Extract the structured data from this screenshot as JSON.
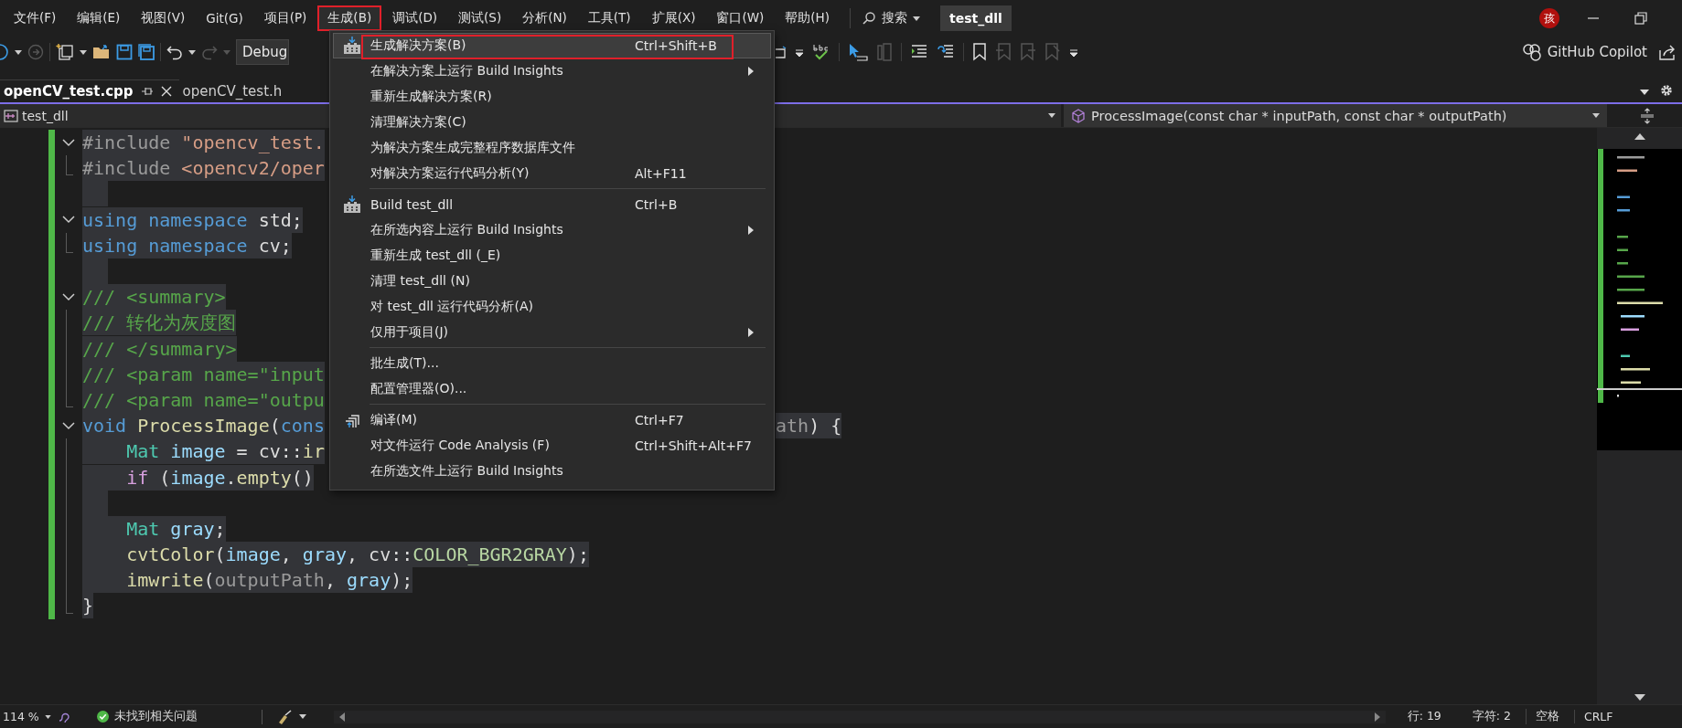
{
  "menubar": {
    "items": [
      {
        "label": "文件(F)",
        "selected": false,
        "outlined": false
      },
      {
        "label": "编辑(E)",
        "selected": false,
        "outlined": false
      },
      {
        "label": "视图(V)",
        "selected": false,
        "outlined": false
      },
      {
        "label": "Git(G)",
        "selected": false,
        "outlined": false
      },
      {
        "label": "项目(P)",
        "selected": false,
        "outlined": false
      },
      {
        "label": "生成(B)",
        "selected": true,
        "outlined": true
      },
      {
        "label": "调试(D)",
        "selected": false,
        "outlined": false
      },
      {
        "label": "测试(S)",
        "selected": false,
        "outlined": false
      },
      {
        "label": "分析(N)",
        "selected": false,
        "outlined": false
      },
      {
        "label": "工具(T)",
        "selected": false,
        "outlined": false
      },
      {
        "label": "扩展(X)",
        "selected": false,
        "outlined": false
      },
      {
        "label": "窗口(W)",
        "selected": false,
        "outlined": false
      },
      {
        "label": "帮助(H)",
        "selected": false,
        "outlined": false
      }
    ],
    "search": "搜索",
    "solution": "test_dll",
    "avatar": "孩"
  },
  "toolbar": {
    "configuration": "Debug",
    "copilot": "GitHub Copilot"
  },
  "tabs": [
    {
      "label": "openCV_test.cpp",
      "selected": true
    },
    {
      "label": "openCV_test.h",
      "selected": false
    }
  ],
  "navbar": {
    "project": "test_dll",
    "member": "ProcessImage(const char * inputPath, const char * outputPath)"
  },
  "editor": {
    "lines": [
      {
        "kind": "opening",
        "selected": true,
        "tokens": [
          {
            "text": "#include",
            "kind": "directive"
          },
          {
            "text": " \"opencv_test.",
            "kind": "string"
          }
        ]
      },
      {
        "kind": "closing",
        "selected": true,
        "tokens": [
          {
            "text": "#include",
            "kind": "directive"
          },
          {
            "text": " <opencv2/oper",
            "kind": "string"
          }
        ]
      },
      {
        "kind": "plain",
        "selected": true
      },
      {
        "kind": "opening",
        "selected": true,
        "tokens": [
          {
            "text": "using",
            "kind": "keyword"
          },
          {
            "text": " namespace",
            "kind": "keyword"
          },
          {
            "text": " std;",
            "kind": "plain"
          }
        ]
      },
      {
        "kind": "closing",
        "selected": true,
        "tokens": [
          {
            "text": "using",
            "kind": "keyword"
          },
          {
            "text": " namespace",
            "kind": "keyword"
          },
          {
            "text": " cv;",
            "kind": "plain"
          }
        ]
      },
      {
        "kind": "plain",
        "selected": true
      },
      {
        "kind": "opening",
        "selected": true,
        "tokens": [
          {
            "text": "/// <summary>",
            "kind": "comment"
          }
        ]
      },
      {
        "kind": "inner",
        "selected": true,
        "tokens": [
          {
            "text": "/// 转化为灰度图",
            "kind": "comment"
          }
        ]
      },
      {
        "kind": "inner",
        "selected": true,
        "tokens": [
          {
            "text": "/// </summary>",
            "kind": "comment"
          }
        ]
      },
      {
        "kind": "inner",
        "selected": true,
        "tokens": [
          {
            "text": "/// <param name=\"input",
            "kind": "comment"
          }
        ]
      },
      {
        "kind": "closing",
        "selected": true,
        "tokens": [
          {
            "text": "/// <param name=\"outpu",
            "kind": "comment"
          }
        ]
      },
      {
        "kind": "opening",
        "selected": true,
        "tokens": [
          {
            "text": "void",
            "kind": "keyword"
          },
          {
            "text": " ProcessImage",
            "kind": "function"
          },
          {
            "text": "(",
            "kind": "plain"
          },
          {
            "text": "cons",
            "kind": "keyword"
          }
        ],
        "tail": [
          {
            "text": "ath",
            "kind": "parameter"
          },
          {
            "text": ") {",
            "kind": "plain"
          }
        ]
      },
      {
        "kind": "inner",
        "selected": true,
        "tokens": [
          {
            "text": "    Mat",
            "kind": "type"
          },
          {
            "text": " image",
            "kind": "variable"
          },
          {
            "text": " = cv::",
            "kind": "plain"
          },
          {
            "text": "ir",
            "kind": "function"
          }
        ]
      },
      {
        "kind": "inner",
        "selected": true,
        "tokens": [
          {
            "text": "    if",
            "kind": "control"
          },
          {
            "text": " (",
            "kind": "plain"
          },
          {
            "text": "image",
            "kind": "variable"
          },
          {
            "text": ".",
            "kind": "plain"
          },
          {
            "text": "empty",
            "kind": "function"
          },
          {
            "text": "()",
            "kind": "plain"
          }
        ]
      },
      {
        "kind": "inner",
        "selected": true
      },
      {
        "kind": "inner",
        "selected": true,
        "tokens": [
          {
            "text": "    Mat",
            "kind": "type"
          },
          {
            "text": " gray",
            "kind": "variable"
          },
          {
            "text": ";",
            "kind": "plain"
          }
        ]
      },
      {
        "kind": "inner",
        "selected": true,
        "tokens": [
          {
            "text": "    cvtColor",
            "kind": "function"
          },
          {
            "text": "(",
            "kind": "plain"
          },
          {
            "text": "image",
            "kind": "variable"
          },
          {
            "text": ", ",
            "kind": "plain"
          },
          {
            "text": "gray",
            "kind": "variable"
          },
          {
            "text": ", cv::",
            "kind": "plain"
          },
          {
            "text": "COLOR_BGR2GRAY",
            "kind": "constant"
          },
          {
            "text": ");",
            "kind": "plain"
          }
        ]
      },
      {
        "kind": "inner",
        "selected": true,
        "tokens": [
          {
            "text": "    imwrite",
            "kind": "function"
          },
          {
            "text": "(",
            "kind": "plain"
          },
          {
            "text": "outputPath",
            "kind": "parameter"
          },
          {
            "text": ", ",
            "kind": "plain"
          },
          {
            "text": "gray",
            "kind": "variable"
          },
          {
            "text": ");",
            "kind": "plain"
          }
        ]
      },
      {
        "kind": "closing",
        "selected": true,
        "tokens": [
          {
            "text": "}",
            "kind": "plain"
          }
        ]
      }
    ]
  },
  "menu": {
    "items": [
      {
        "kind": "build",
        "label": "生成解决方案(B)",
        "shortcut": "Ctrl+Shift+B",
        "submenu": false,
        "selected": true,
        "outlined": true
      },
      {
        "kind": "plain",
        "label": "在解决方案上运行 Build Insights",
        "submenu": true,
        "selected": false,
        "outlined": false
      },
      {
        "kind": "plain",
        "label": "重新生成解决方案(R)",
        "submenu": false,
        "selected": false,
        "outlined": false
      },
      {
        "kind": "plain",
        "label": "清理解决方案(C)",
        "submenu": false,
        "selected": false,
        "outlined": false
      },
      {
        "kind": "plain",
        "label": "为解决方案生成完整程序数据库文件",
        "submenu": false,
        "selected": false,
        "outlined": false
      },
      {
        "kind": "plain",
        "label": "对解决方案运行代码分析(Y)",
        "shortcut": "Alt+F11",
        "submenu": false,
        "selected": false,
        "outlined": false
      },
      {
        "kind": "separator"
      },
      {
        "kind": "build",
        "label": "Build test_dll",
        "shortcut": "Ctrl+B",
        "submenu": false,
        "selected": false,
        "outlined": false
      },
      {
        "kind": "plain",
        "label": "在所选内容上运行 Build Insights",
        "submenu": true,
        "selected": false,
        "outlined": false
      },
      {
        "kind": "plain",
        "label": "重新生成 test_dll (_E)",
        "submenu": false,
        "selected": false,
        "outlined": false
      },
      {
        "kind": "plain",
        "label": "清理 test_dll (N)",
        "submenu": false,
        "selected": false,
        "outlined": false
      },
      {
        "kind": "plain",
        "label": "对 test_dll 运行代码分析(A)",
        "submenu": false,
        "selected": false,
        "outlined": false
      },
      {
        "kind": "plain",
        "label": "仅用于项目(J)",
        "submenu": true,
        "selected": false,
        "outlined": false
      },
      {
        "kind": "separator"
      },
      {
        "kind": "plain",
        "label": "批生成(T)...",
        "submenu": false,
        "selected": false,
        "outlined": false
      },
      {
        "kind": "plain",
        "label": "配置管理器(O)...",
        "submenu": false,
        "selected": false,
        "outlined": false
      },
      {
        "kind": "separator"
      },
      {
        "kind": "compile",
        "label": "编译(M)",
        "shortcut": "Ctrl+F7",
        "submenu": false,
        "selected": false,
        "outlined": false
      },
      {
        "kind": "plain",
        "label": "对文件运行 Code Analysis (F)",
        "shortcut": "Ctrl+Shift+Alt+F7",
        "submenu": false,
        "selected": false,
        "outlined": false
      },
      {
        "kind": "plain",
        "label": "在所选文件上运行 Build Insights",
        "submenu": false,
        "selected": false,
        "outlined": false
      }
    ]
  },
  "status_bar": {
    "zoom": "114 %",
    "issues": "未找到相关问题",
    "line": "行: 19",
    "column": "字符: 2",
    "indent": "空格",
    "line_ending": "CRLF"
  }
}
